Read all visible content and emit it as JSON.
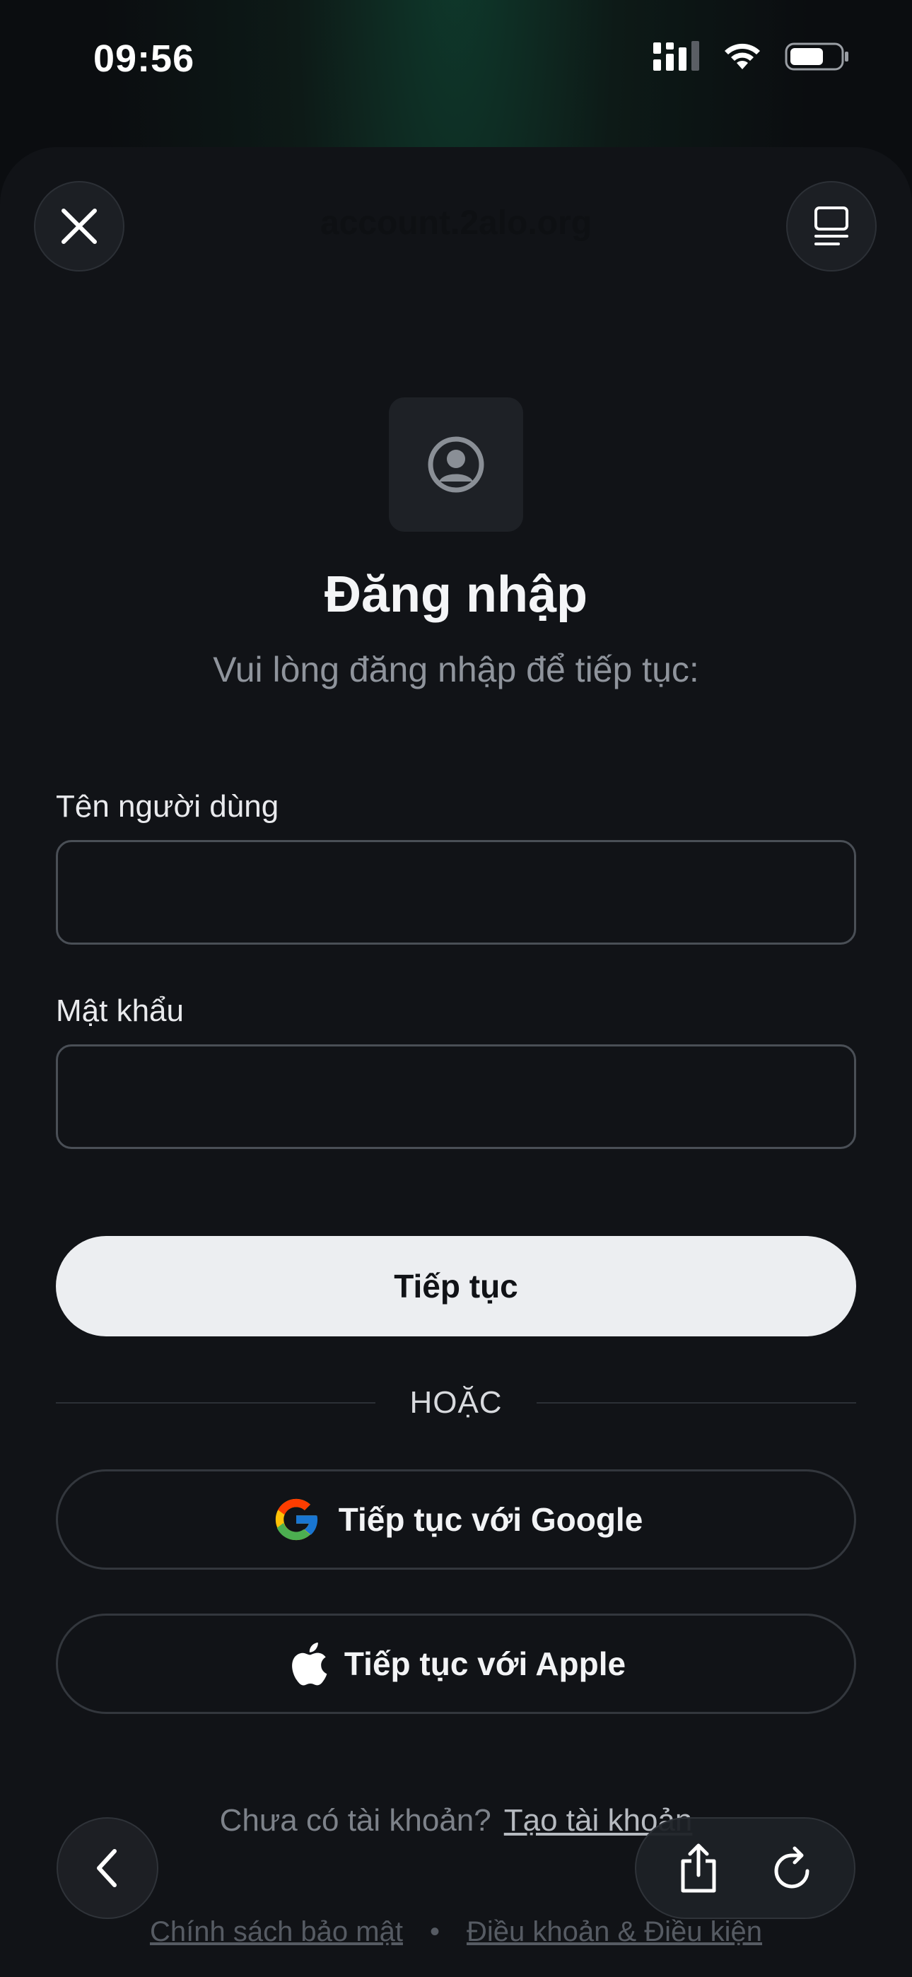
{
  "status_bar": {
    "time": "09:56"
  },
  "browser": {
    "url": "account.2alo.org"
  },
  "login": {
    "title": "Đăng nhập",
    "subtitle": "Vui lòng đăng nhập để tiếp tục:",
    "username_label": "Tên người dùng",
    "username_value": "",
    "password_label": "Mật khẩu",
    "password_value": "",
    "continue_label": "Tiếp tục",
    "divider_text": "HOẶC",
    "google_label": "Tiếp tục với Google",
    "apple_label": "Tiếp tục với Apple",
    "no_account_text": "Chưa có tài khoản?",
    "create_account_link": "Tạo tài khoản"
  },
  "footer": {
    "privacy_link": "Chính sách bảo mật",
    "terms_link": "Điều khoản & Điều kiện"
  },
  "colors": {
    "background": "#111317",
    "primary_button": "#eceef1",
    "text_muted": "#8f949c"
  },
  "icons": {
    "close": "close-icon",
    "reader": "reader-mode-icon",
    "avatar": "user-circle-icon",
    "google": "google-logo-icon",
    "apple": "apple-logo-icon",
    "back": "chevron-left-icon",
    "share": "share-icon",
    "reload": "reload-icon"
  }
}
